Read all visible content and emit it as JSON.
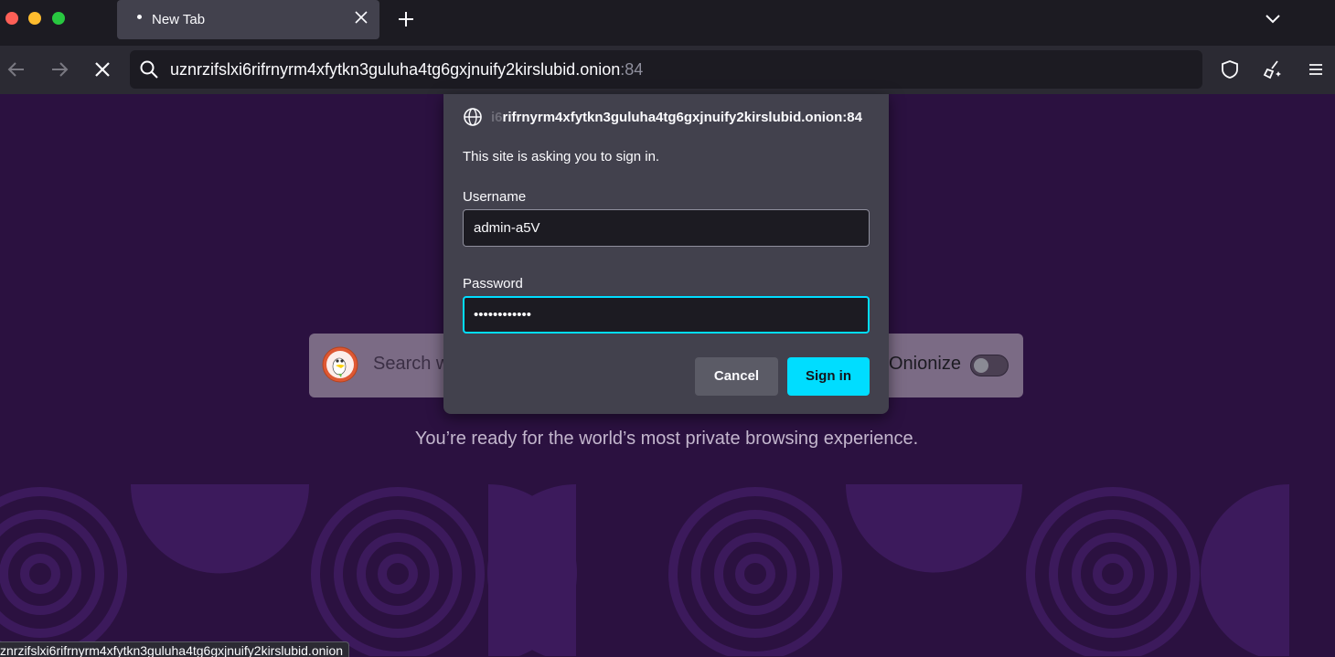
{
  "window": {
    "tab": {
      "title": "New Tab"
    }
  },
  "navbar": {
    "url_host": "uznrzifslxi6rifrnyrm4xfytkn3guluha4tg6gxjnuify2kirslubid.onion",
    "url_port": ":84"
  },
  "page": {
    "search_placeholder": "Search w",
    "onionize_label": "Onionize",
    "onionize_enabled": false,
    "tagline": "You’re ready for the world’s most private browsing experience."
  },
  "dialog": {
    "origin_faded": "i6",
    "origin_visible": "rifrnyrm4xfytkn3guluha4tg6gxjnuify2kirslubid.onion:84",
    "message": "This site is asking you to sign in.",
    "username_label": "Username",
    "username_value": "admin-a5V",
    "password_label": "Password",
    "password_value": "••••••••••••",
    "cancel_label": "Cancel",
    "signin_label": "Sign in"
  },
  "status_bar": {
    "text": "znrzifslxi6rifrnyrm4xfytkn3guluha4tg6gxjnuify2kirslubid.onion"
  },
  "colors": {
    "accent": "#00ddff",
    "page_bg": "#2b1140",
    "dialog_bg": "#42414d"
  }
}
